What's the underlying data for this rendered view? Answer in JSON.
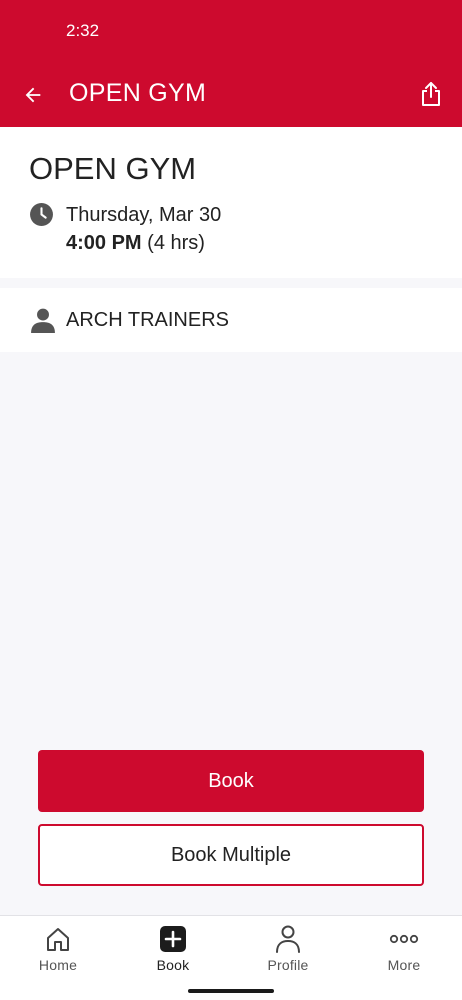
{
  "status_bar": {
    "time": "2:32"
  },
  "header": {
    "title": "OPEN GYM",
    "back_icon": "arrow-left-icon",
    "share_icon": "share-icon",
    "background_color": "#cd0a2e"
  },
  "event": {
    "title": "OPEN GYM",
    "date": "Thursday, Mar 30",
    "time": "4:00 PM",
    "duration": "(4 hrs)",
    "clock_icon": "clock-icon"
  },
  "trainer": {
    "name": "ARCH TRAINERS",
    "icon": "person-icon"
  },
  "actions": {
    "book_label": "Book",
    "book_multiple_label": "Book Multiple"
  },
  "bottom_nav": {
    "items": [
      {
        "label": "Home",
        "icon": "home-icon",
        "active": false
      },
      {
        "label": "Book",
        "icon": "plus-square-icon",
        "active": true
      },
      {
        "label": "Profile",
        "icon": "profile-icon",
        "active": false
      },
      {
        "label": "More",
        "icon": "more-dots-icon",
        "active": false
      }
    ]
  },
  "colors": {
    "brand": "#cd0a2e",
    "background": "#f7f7fa",
    "text": "#222222"
  }
}
